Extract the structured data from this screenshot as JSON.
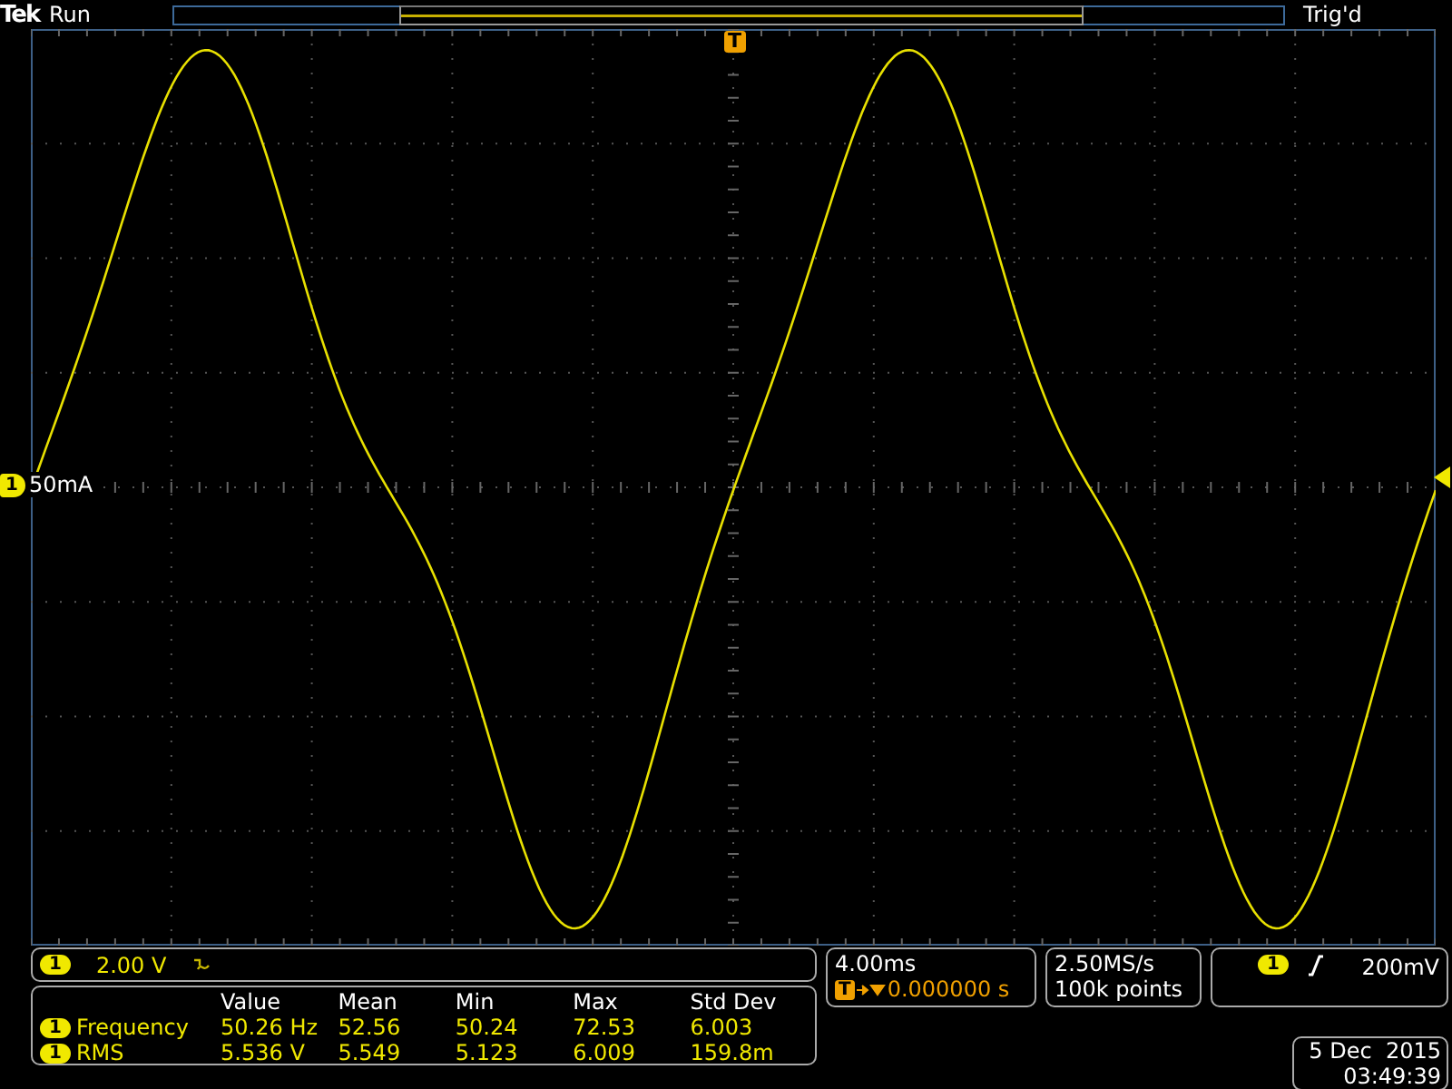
{
  "header": {
    "brand": "Tek",
    "run_state": "Run",
    "trigger_status": "Trig'd",
    "trigger_marker": "T"
  },
  "channel_marker": {
    "number": "1",
    "offset_label": "50mA"
  },
  "vertical": {
    "channel": "1",
    "scale": "2.00 V"
  },
  "measurements": {
    "columns": [
      "Value",
      "Mean",
      "Min",
      "Max",
      "Std Dev"
    ],
    "rows": [
      {
        "channel": "1",
        "name": "Frequency",
        "values": [
          "50.26 Hz",
          "52.56",
          "50.24",
          "72.53",
          "6.003"
        ]
      },
      {
        "channel": "1",
        "name": "RMS",
        "values": [
          "5.536 V",
          "5.549",
          "5.123",
          "6.009",
          "159.8m"
        ]
      }
    ]
  },
  "horizontal": {
    "scale": "4.00ms",
    "trigger_marker": "T",
    "position": "0.000000 s"
  },
  "acquisition": {
    "sample_rate": "2.50MS/s",
    "record_length": "100k points"
  },
  "trigger": {
    "channel": "1",
    "level": "200mV"
  },
  "datetime": {
    "date": "5 Dec  2015",
    "time": "03:49:39"
  }
}
